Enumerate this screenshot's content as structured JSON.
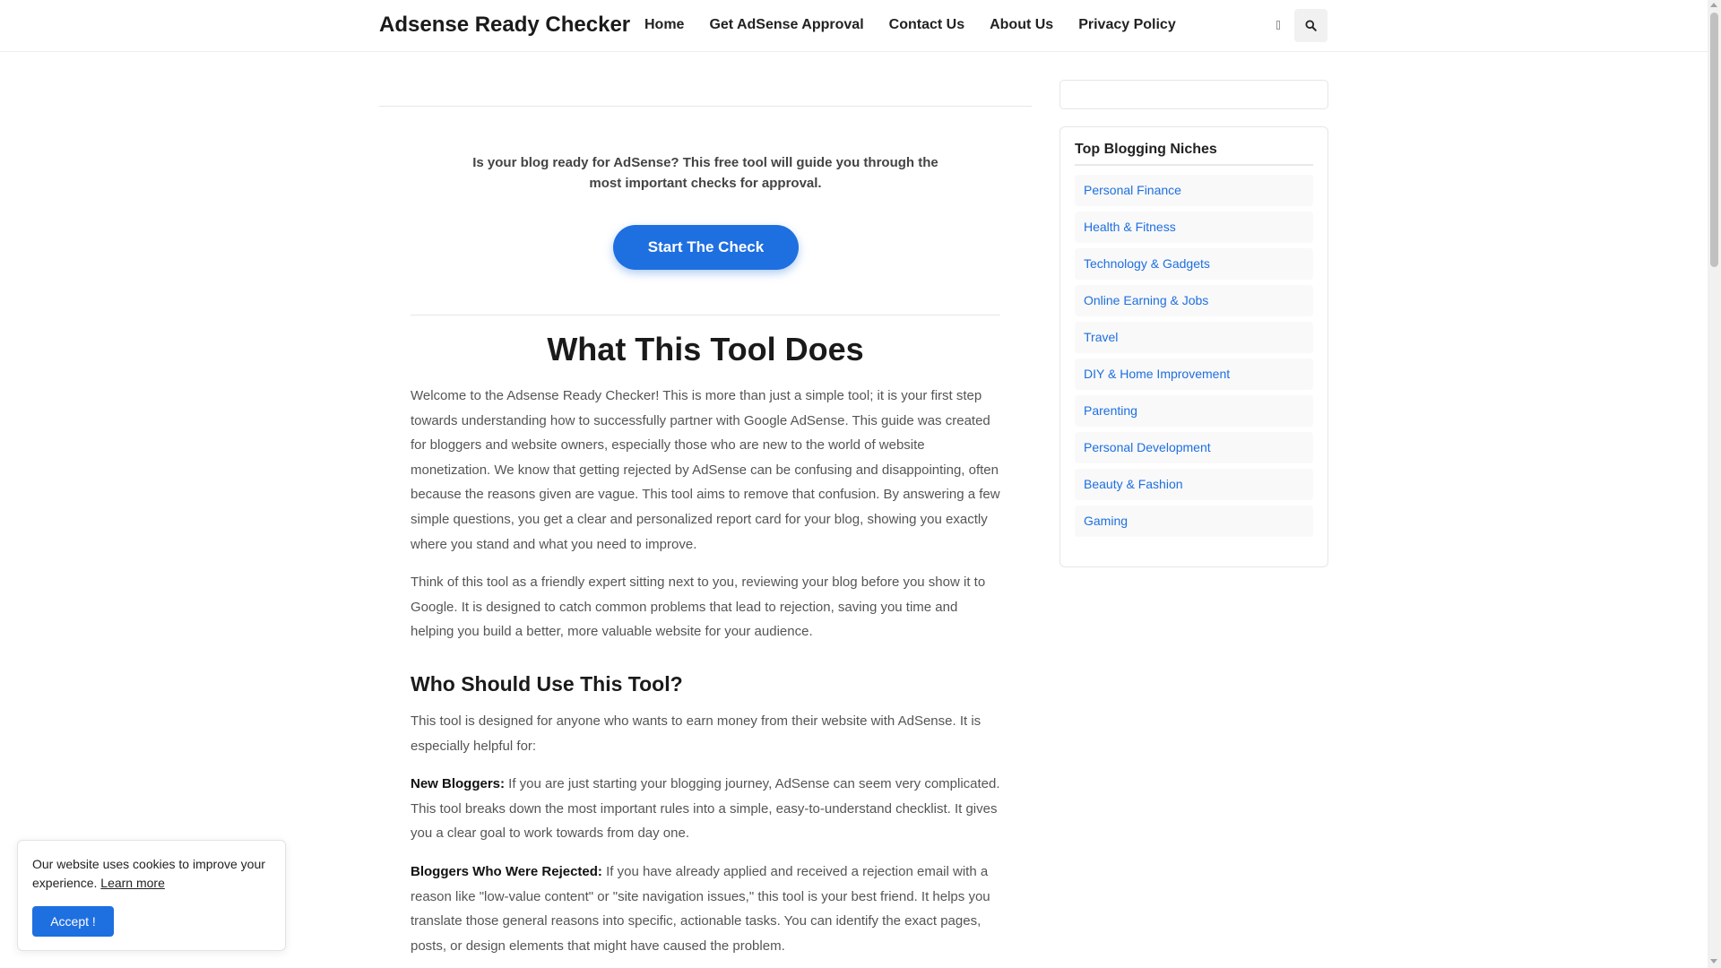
{
  "header": {
    "brand": "Adsense Ready Checker",
    "nav": [
      "Home",
      "Get AdSense Approval",
      "Contact Us",
      "About Us",
      "Privacy Policy"
    ],
    "mode_icon": "contrast-icon",
    "search_icon": "search-icon"
  },
  "hero": {
    "intro": "Is your blog ready for AdSense? This free tool will guide you through the most important checks for approval.",
    "start_button": "Start The Check"
  },
  "article": {
    "title": "What This Tool Does",
    "p1": "Welcome to the Adsense Ready Checker! This is more than just a simple tool; it is your first step towards understanding how to successfully partner with Google AdSense. This guide was created for bloggers and website owners, especially those who are new to the world of website monetization. We know that getting rejected by AdSense can be confusing and disappointing, often because the reasons given are vague. This tool aims to remove that confusion. By answering a few simple questions, you get a clear and personalized report card for your blog, showing you exactly where you stand and what you need to improve.",
    "p2": "Think of this tool as a friendly expert sitting next to you, reviewing your blog before you show it to Google. It is designed to catch common problems that lead to rejection, saving you time and helping you build a better, more valuable website for your audience.",
    "h2": "Who Should Use This Tool?",
    "p3": "This tool is designed for anyone who wants to earn money from their website with AdSense. It is especially helpful for:",
    "new_bloggers_label": "New Bloggers:",
    "new_bloggers_text": " If you are just starting your blogging journey, AdSense can seem very complicated. This tool breaks down the most important rules into a simple, easy-to-understand checklist. It gives you a clear goal to work towards from day one.",
    "rejected_label": "Bloggers Who Were Rejected:",
    "rejected_text": " If you have already applied and received a rejection email with a reason like \"low-value content\" or \"site navigation issues,\" this tool is your best friend. It helps you translate those general reasons into specific, actionable tasks. You can identify the exact pages, posts, or design elements that might have caused the problem."
  },
  "sidebar": {
    "widget_title": "Top Blogging Niches",
    "niches": [
      "Personal Finance",
      "Health & Fitness",
      "Technology & Gadgets",
      "Online Earning & Jobs",
      "Travel",
      "DIY & Home Improvement",
      "Parenting",
      "Personal Development",
      "Beauty & Fashion",
      "Gaming"
    ]
  },
  "cookie": {
    "text": "Our website uses cookies to improve your experience. ",
    "learn_more": "Learn more",
    "accept": "Accept !"
  },
  "colors": {
    "accent": "#1e6fe0"
  }
}
